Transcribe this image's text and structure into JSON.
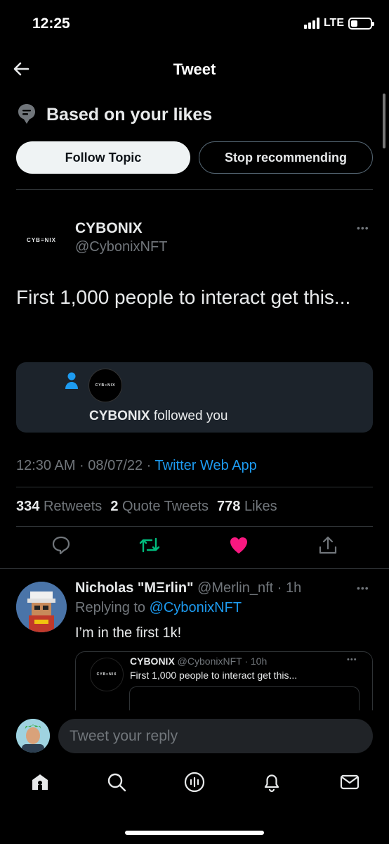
{
  "status_bar": {
    "time": "12:25",
    "network": "LTE"
  },
  "header": {
    "title": "Tweet"
  },
  "recommendation": {
    "title": "Based on your likes",
    "follow_label": "Follow Topic",
    "stop_label": "Stop recommending"
  },
  "tweet": {
    "logo_text": "CYB≡NIX",
    "display_name": "CYBONIX",
    "handle": "@CybonixNFT",
    "text": "First 1,000 people to interact get this...",
    "embed": {
      "logo_text": "CYB≡NIX",
      "name": "CYBONIX",
      "action": " followed you"
    },
    "time": "12:30 AM · 08/07/22 · ",
    "source": "Twitter Web App",
    "stats": {
      "retweets_count": "334",
      "retweets_label": "Retweets",
      "quotes_count": "2",
      "quotes_label": "Quote Tweets",
      "likes_count": "778",
      "likes_label": "Likes"
    },
    "actions": [
      "reply-icon",
      "retweet-icon",
      "like-icon",
      "share-icon"
    ],
    "colors": {
      "retweet": "#00ba7c",
      "like": "#f91880",
      "link": "#1d9bf0"
    }
  },
  "reply": {
    "display_name": "Nicholas \"MΞrlin\"",
    "handle_time": " @Merlin_nft · 1h",
    "replying_prefix": "Replying to ",
    "replying_handle": "@CybonixNFT",
    "text": "I’m in the first 1k!",
    "quote": {
      "logo_text": "CYB≡NIX",
      "name": "CYBONIX",
      "handle_time": " @CybonixNFT · 10h",
      "text": "First 1,000 people to interact get this..."
    }
  },
  "composer": {
    "placeholder": "Tweet your reply"
  },
  "tabbar": {
    "items": [
      "home-icon",
      "search-icon",
      "spaces-icon",
      "notifications-icon",
      "messages-icon"
    ]
  }
}
